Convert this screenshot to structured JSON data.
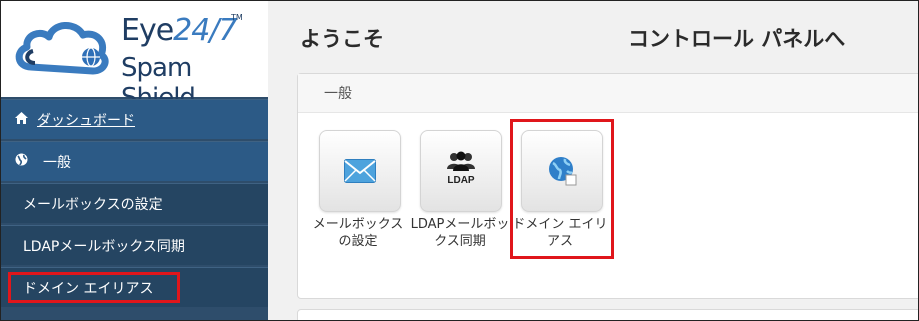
{
  "brand": {
    "line1": "Eye",
    "line1b": "24/7",
    "tm": "TM",
    "line2": "Spam Shield",
    "primary_color": "#1f3d63"
  },
  "sidebar": {
    "items": [
      {
        "label": "ダッシュボード",
        "icon": "home-icon"
      },
      {
        "label": "一般",
        "icon": "globe-icon"
      },
      {
        "label": "メールボックスの設定"
      },
      {
        "label": "LDAPメールボックス同期"
      },
      {
        "label": "ドメイン エイリアス"
      }
    ],
    "highlight_color": "#e0161b"
  },
  "header": {
    "welcome": "ようこそ",
    "control_panel": "コントロール パネルへ"
  },
  "panel": {
    "title": "一般",
    "tiles": [
      {
        "caption": "メールボックスの設定",
        "icon": "envelope-icon"
      },
      {
        "caption": "LDAPメールボックス同期",
        "icon": "ldap-users-icon",
        "icon_text": "LDAP"
      },
      {
        "caption": "ドメイン エイリアス",
        "icon": "globe-icon"
      }
    ]
  }
}
